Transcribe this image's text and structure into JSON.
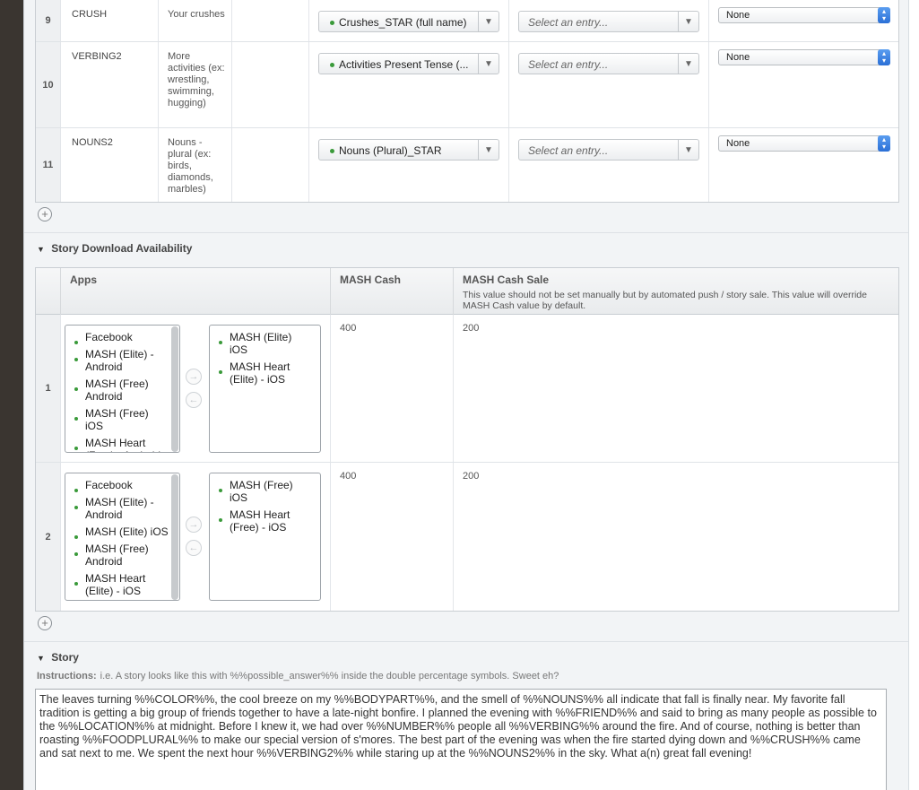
{
  "variables": [
    {
      "num": "9",
      "key": "CRUSH",
      "desc": "Your crushes",
      "category": "Crushes_STAR (full name)",
      "entry_placeholder": "Select an entry...",
      "option": "None"
    },
    {
      "num": "10",
      "key": "VERBING2",
      "desc": "More activities (ex: wrestling, swimming, hugging)",
      "category": "Activities Present Tense (...",
      "entry_placeholder": "Select an entry...",
      "option": "None"
    },
    {
      "num": "11",
      "key": "NOUNS2",
      "desc": "Nouns - plural (ex: birds, diamonds, marbles)",
      "category": "Nouns (Plural)_STAR",
      "entry_placeholder": "Select an entry...",
      "option": "None"
    }
  ],
  "download": {
    "section_title": "Story Download Availability",
    "headers": {
      "apps": "Apps",
      "cash": "MASH Cash",
      "sale": "MASH Cash Sale",
      "sale_note": "This value should not be set manually but by automated push / story sale. This value will override MASH Cash value by default."
    },
    "rows": [
      {
        "num": "1",
        "available": [
          "Facebook",
          "MASH (Elite) - Android",
          "MASH (Free) Android",
          "MASH (Free) iOS",
          "MASH Heart (Free) - Android"
        ],
        "selected": [
          "MASH (Elite) iOS",
          "MASH Heart (Elite) - iOS"
        ],
        "cash": "400",
        "sale": "200"
      },
      {
        "num": "2",
        "available": [
          "Facebook",
          "MASH (Elite) - Android",
          "MASH (Elite) iOS",
          "MASH (Free) Android",
          "MASH Heart (Elite) - iOS"
        ],
        "selected": [
          "MASH (Free) iOS",
          "MASH Heart (Free) - iOS"
        ],
        "cash": "400",
        "sale": "200"
      }
    ]
  },
  "story": {
    "section_title": "Story",
    "instructions_label": "Instructions:",
    "instructions_text": "i.e. A story looks like this with %%possible_answer%% inside the double percentage symbols. Sweet eh?",
    "text": "The leaves turning %%COLOR%%, the cool breeze on my %%BODYPART%%, and the smell of %%NOUNS%% all indicate that fall is finally near. My favorite fall tradition is getting a big group of friends together to have a late-night bonfire. I planned the evening with %%FRIEND%% and said to bring as many people as possible to the %%LOCATION%% at midnight. Before I knew it, we had over %%NUMBER%% people all %%VERBING%% around the fire. And of course, nothing is better than roasting %%FOODPLURAL%% to make our special version of s'mores. The best part of the evening was when the fire started dying down and %%CRUSH%% came and sat next to me. We spent the next hour %%VERBING2%% while staring up at the %%NOUNS2%% in the sky. What a(n) great fall evening!"
  },
  "icons": {
    "add": "+",
    "arrow_right": "→",
    "arrow_left": "←",
    "dropdown": "▼",
    "collapse": "▼"
  }
}
